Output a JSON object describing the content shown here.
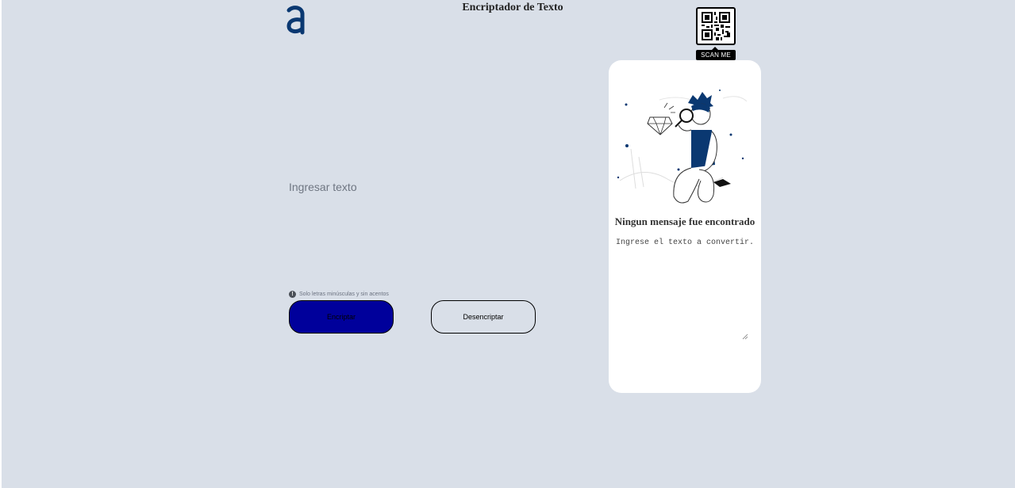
{
  "header": {
    "title": "Encriptador de Texto",
    "logo_icon": "alura-logo-icon"
  },
  "qr": {
    "label": "SCAN ME",
    "icon": "qr-code-icon"
  },
  "editor": {
    "placeholder": "Ingresar texto",
    "value": ""
  },
  "hint": {
    "icon": "info-icon",
    "text": "Solo letras minúsculas y sin acentos"
  },
  "buttons": {
    "encrypt_label": "Encriptar",
    "decrypt_label": "Desencriptar"
  },
  "output": {
    "title": "Ningun mensaje fue encontrado",
    "subtitle": "Ingrese el texto a convertir."
  },
  "colors": {
    "background": "#d9dfe8",
    "brand": "#0a3871",
    "encrypt_button": "#00009b",
    "panel": "#ffffff"
  }
}
